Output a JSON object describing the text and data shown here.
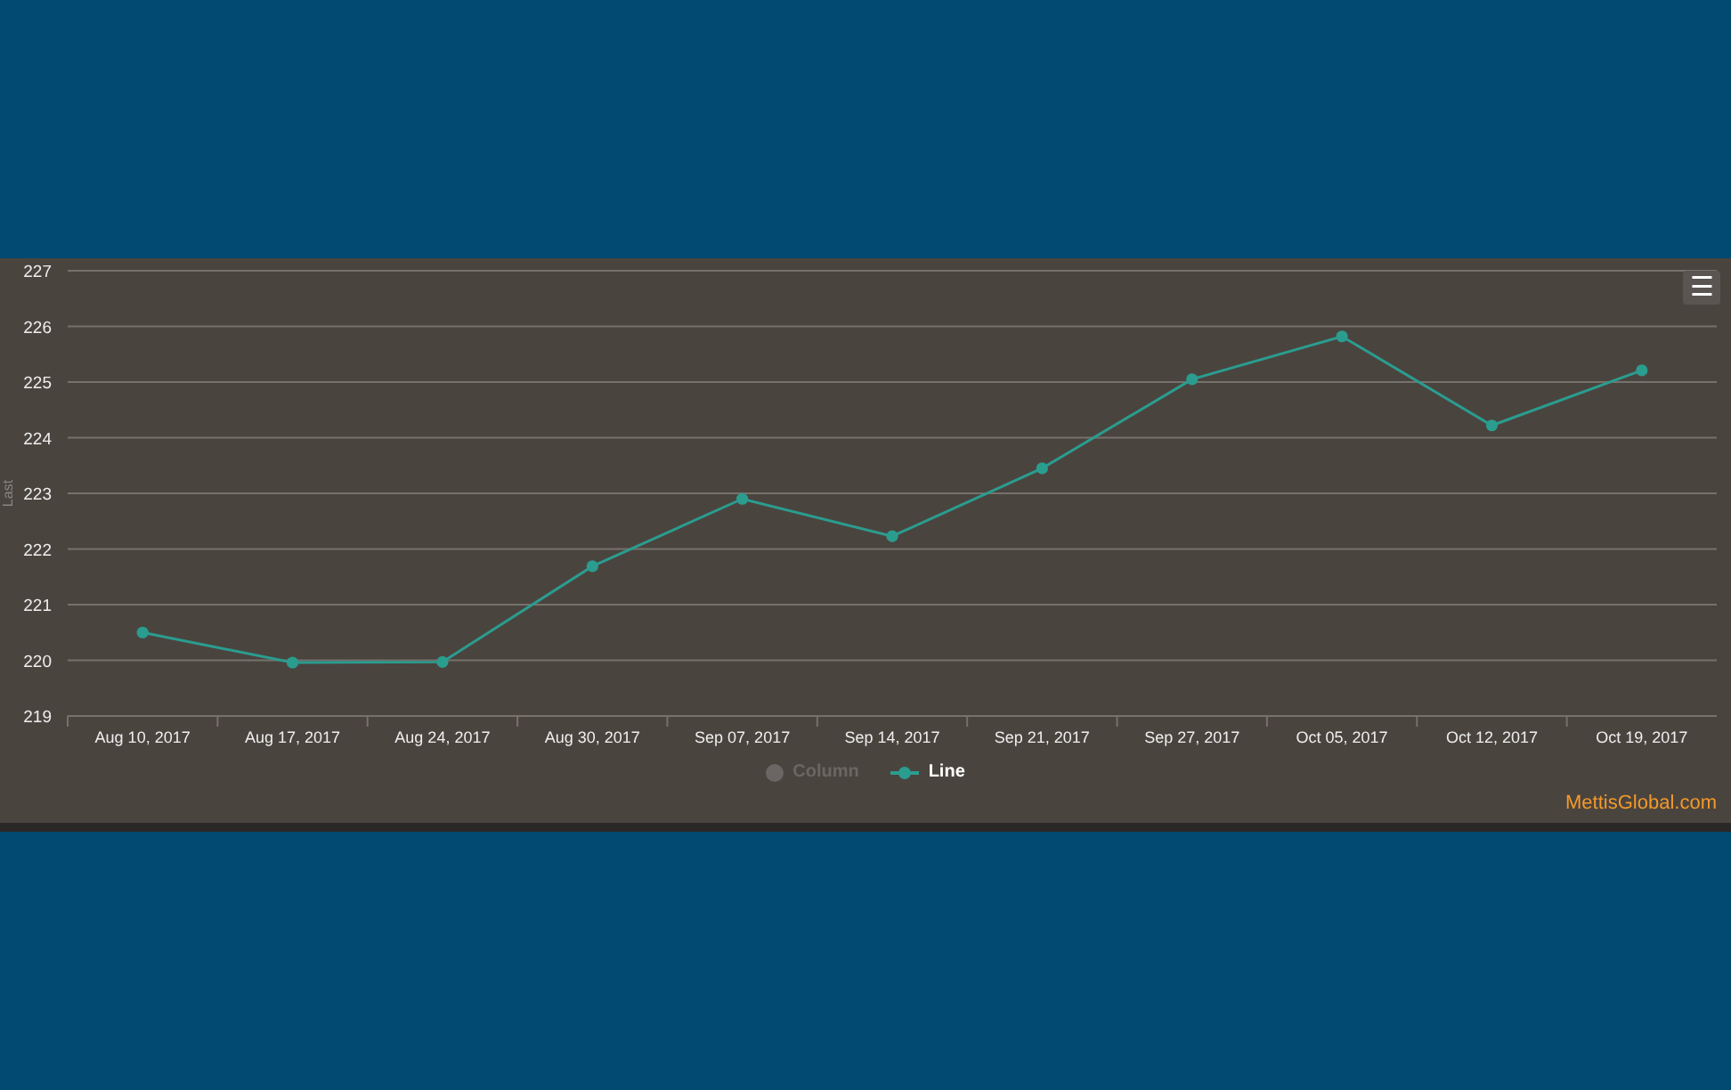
{
  "chart": {
    "menu_icon": "☰",
    "chart_data": {
      "type": "line",
      "ylabel": "Last",
      "categories": [
        "Aug 10, 2017",
        "Aug 17, 2017",
        "Aug 24, 2017",
        "Aug 30, 2017",
        "Sep 07, 2017",
        "Sep 14, 2017",
        "Sep 21, 2017",
        "Sep 27, 2017",
        "Oct 05, 2017",
        "Oct 12, 2017",
        "Oct 19, 2017"
      ],
      "grid": true,
      "series": [
        {
          "name": "Line",
          "color": "#2a9d8f",
          "marker": true,
          "values": [
            220.5,
            219.96,
            219.97,
            221.69,
            222.9,
            222.23,
            223.45,
            225.05,
            225.82,
            224.22,
            225.21
          ]
        }
      ],
      "ylim": [
        219,
        227
      ],
      "yticks": [
        219,
        220,
        221,
        222,
        223,
        224,
        225,
        226,
        227
      ]
    },
    "legend": [
      {
        "label": "Column",
        "visible": false,
        "kind": "column"
      },
      {
        "visible": true,
        "kind": "line"
      }
    ],
    "credit": "MettisGlobal.com"
  }
}
